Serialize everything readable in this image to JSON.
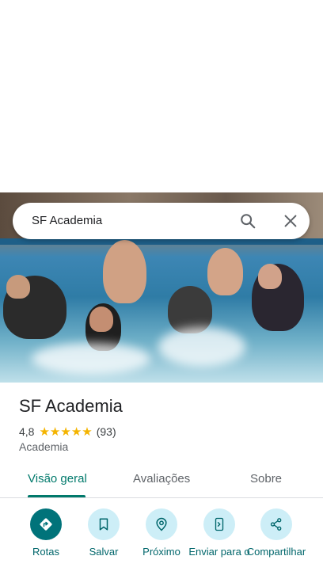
{
  "search": {
    "query": "SF Academia",
    "search_icon": "search-icon",
    "close_icon": "close-icon"
  },
  "place": {
    "name": "SF Academia",
    "rating": "4,8",
    "stars": 5,
    "review_count": "(93)",
    "category": "Academia"
  },
  "tabs": [
    {
      "label": "Visão geral",
      "active": true
    },
    {
      "label": "Avaliações",
      "active": false
    },
    {
      "label": "Sobre",
      "active": false
    }
  ],
  "actions": [
    {
      "label": "Rotas",
      "icon": "directions-icon"
    },
    {
      "label": "Salvar",
      "icon": "bookmark-icon"
    },
    {
      "label": "Próximo",
      "icon": "nearby-icon"
    },
    {
      "label": "Enviar para o",
      "icon": "send-to-phone-icon"
    },
    {
      "label": "Compartilhar",
      "icon": "share-icon"
    }
  ],
  "colors": {
    "accent": "#00796b",
    "star": "#f4b400",
    "action_bg": "#cdeef7",
    "primary_action": "#00737a"
  }
}
